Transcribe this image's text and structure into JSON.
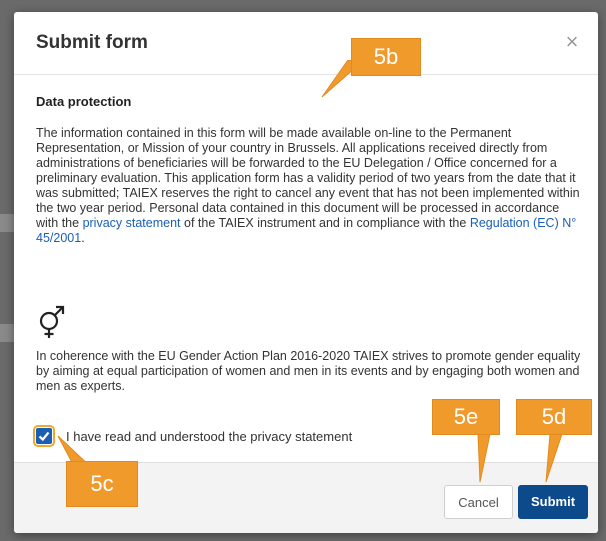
{
  "modal": {
    "title": "Submit form",
    "close_label": "×"
  },
  "data_protection": {
    "heading": "Data protection",
    "paragraph_part1": "The information contained in this form will be made available on-line to the Permanent Representation, or Mission of your country in Brussels. All applications received directly from administrations of beneficiaries will be forwarded to the EU Delegation / Office concerned for a preliminary evaluation. This application form has a validity period of two years from the date that it was submitted; TAIEX reserves the right to cancel any event that has not been implemented within the two year period. Personal data contained in this document will be processed in accordance with the ",
    "privacy_link": "privacy statement",
    "paragraph_part2": " of the TAIEX instrument and in compliance with the ",
    "regulation_link": "Regulation (EC) N° 45/2001",
    "paragraph_end": "."
  },
  "gender": {
    "icon": "gender-symbol-icon",
    "text": "In coherence with the EU Gender Action Plan 2016-2020 TAIEX strives to promote gender equality by aiming at equal participation of women and men in its events and by engaging both women and men as experts."
  },
  "consent": {
    "label": "I have read and understood the privacy statement",
    "checked": true
  },
  "footer": {
    "cancel_label": "Cancel",
    "submit_label": "Submit"
  },
  "annotations": {
    "b": "5b",
    "c": "5c",
    "d": "5d",
    "e": "5e"
  },
  "colors": {
    "primary": "#0c4a8c",
    "link": "#1a5fb4",
    "callout": "#f19a2c"
  }
}
